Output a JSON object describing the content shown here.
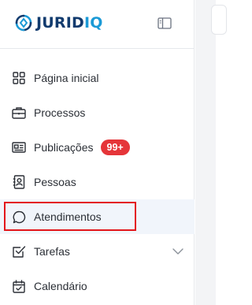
{
  "brand": {
    "name_part1": "JURID",
    "name_part2": "IQ",
    "primary_color": "#123b6e",
    "accent_color": "#1b9ad6"
  },
  "header": {
    "collapse_icon": "sidebar-collapse-icon"
  },
  "sidebar": {
    "items": [
      {
        "label": "Página inicial",
        "icon": "grid-icon"
      },
      {
        "label": "Processos",
        "icon": "briefcase-icon"
      },
      {
        "label": "Publicações",
        "icon": "newspaper-icon",
        "badge": "99+"
      },
      {
        "label": "Pessoas",
        "icon": "contact-book-icon"
      },
      {
        "label": "Atendimentos",
        "icon": "chat-bubble-icon",
        "selected": true
      },
      {
        "label": "Tarefas",
        "icon": "checkbox-icon",
        "expandable": true
      },
      {
        "label": "Calendário",
        "icon": "calendar-check-icon"
      }
    ]
  },
  "colors": {
    "badge": "#e53539",
    "highlight_border": "#e3161b",
    "selected_background": "#f1f5fb"
  }
}
